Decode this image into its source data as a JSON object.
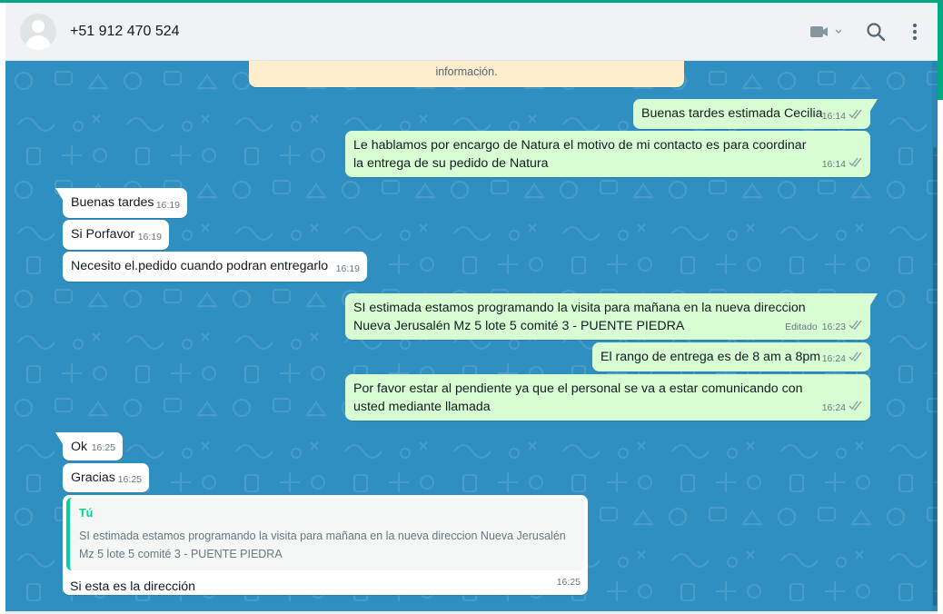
{
  "header": {
    "contact_name": "+51 912 470 524"
  },
  "system_notice": "información.",
  "messages": [
    {
      "text": "Buenas tardes estimada Cecilia",
      "time": "16:14"
    },
    {
      "text": "Le hablamos por encargo de Natura el motivo de mi contacto es para coordinar la entrega de su pedido de Natura",
      "time": "16:14"
    },
    {
      "text": "Buenas tardes",
      "time": "16:19"
    },
    {
      "text": "Si Porfavor",
      "time": "16:19"
    },
    {
      "text": "Necesito el.pedido cuando podran entregarlo",
      "time": "16:19"
    },
    {
      "text": "SI estimada estamos programando la visita para mañana en la nueva direccion Nueva Jerusalén Mz 5 lote 5 comité 3 - PUENTE PIEDRA",
      "time": "16:23",
      "edited": "Editado"
    },
    {
      "text": "El rango de entrega es de 8 am a 8pm",
      "time": "16:24"
    },
    {
      "text": "Por favor estar al pendiente ya que el personal se va a estar comunicando con usted mediante llamada",
      "time": "16:24"
    },
    {
      "text": "Ok",
      "time": "16:25"
    },
    {
      "text": "Gracias",
      "time": "16:25"
    },
    {
      "text": "Si esta es la dirección",
      "time": "16:25",
      "quote_author": "Tú",
      "quote_text": "SI estimada estamos programando la visita para mañana en la nueva direccion Nueva Jerusalén Mz 5 lote 5 comité 3 - PUENTE PIEDRA"
    }
  ],
  "icons": {
    "video": "video-camera-icon",
    "search": "search-icon",
    "menu": "kebab-menu-icon",
    "ticks": "double-check-icon"
  },
  "colors": {
    "outgoing_bubble": "#d9fdd3",
    "incoming_bubble": "#ffffff",
    "chat_background": "#2e8fc0",
    "accent": "#00a884"
  }
}
